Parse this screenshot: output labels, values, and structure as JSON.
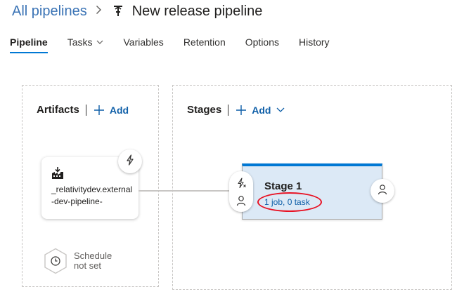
{
  "breadcrumb": {
    "parent": "All pipelines",
    "separator": ">",
    "title": "New release pipeline",
    "title_icon": "release-pipeline-icon"
  },
  "tabs": [
    {
      "label": "Pipeline",
      "active": true
    },
    {
      "label": "Tasks",
      "has_dropdown": true
    },
    {
      "label": "Variables"
    },
    {
      "label": "Retention"
    },
    {
      "label": "Options"
    },
    {
      "label": "History"
    }
  ],
  "artifacts": {
    "title": "Artifacts",
    "add_label": "Add",
    "card": {
      "icon": "build-icon",
      "name": "_relativitydev.external-dev-pipeline-",
      "trigger_icon": "lightning-icon"
    },
    "schedule": {
      "icon": "clock-icon",
      "label": "Schedule not set"
    }
  },
  "stages": {
    "title": "Stages",
    "add_label": "Add",
    "items": [
      {
        "name": "Stage 1",
        "summary": "1 job, 0 task"
      }
    ]
  },
  "colors": {
    "accent": "#0078d4",
    "link": "#0f5fa8",
    "stage_bg": "#dce9f6",
    "highlight": "#e81123"
  }
}
